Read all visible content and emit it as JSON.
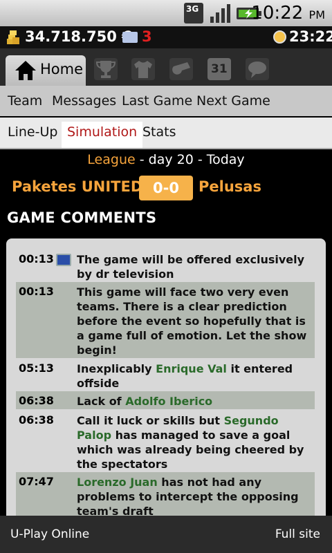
{
  "status_bar": {
    "network": "3G",
    "time": "10:22",
    "ampm": "PM"
  },
  "top_bar": {
    "money": "34.718.750 €",
    "messages_count": "3",
    "game_clock": "23:22"
  },
  "nav": {
    "home_label": "Home",
    "icons": [
      "trophy-icon",
      "shirt-icon",
      "whistle-icon",
      "calendar-icon",
      "chat-icon"
    ],
    "calendar_day": "31"
  },
  "subnav": {
    "team": "Team",
    "messages": "Messages",
    "last_game": "Last Game",
    "next_game": "Next Game"
  },
  "tabs": {
    "lineup": "Line-Up",
    "simulation": "Simulation",
    "stats": "Stats"
  },
  "match": {
    "league_label": "League",
    "day_text": "- day 20 - Today",
    "home_team": "Paketes UNITED",
    "score": "0-0",
    "away_team": "Pelusas"
  },
  "comments_title": "GAME COMMENTS",
  "comments": [
    {
      "time": "00:13",
      "icon": "tv-icon",
      "text": "The game will be offered exclusively by dr television"
    },
    {
      "time": "00:13",
      "text": "This game will face two very even teams. There is a clear prediction before the event so hopefully that is a game full of emotion. Let the show begin!"
    },
    {
      "time": "05:13",
      "pre": "Inexplicably ",
      "name": "Enrique Val",
      "post": " it entered offside"
    },
    {
      "time": "06:38",
      "pre": "Lack of ",
      "name": "Adolfo Iberico",
      "post": ""
    },
    {
      "time": "06:38",
      "pre": "Call it luck or skills but ",
      "name": "Segundo Palop",
      "post": " has managed to save a goal which was already being cheered by the spectators"
    },
    {
      "time": "07:47",
      "pre": "",
      "name": "Lorenzo Juan",
      "post": " has not had any problems to intercept the opposing team's draft"
    }
  ],
  "footer": {
    "left": "U-Play Online",
    "right": "Full site"
  }
}
